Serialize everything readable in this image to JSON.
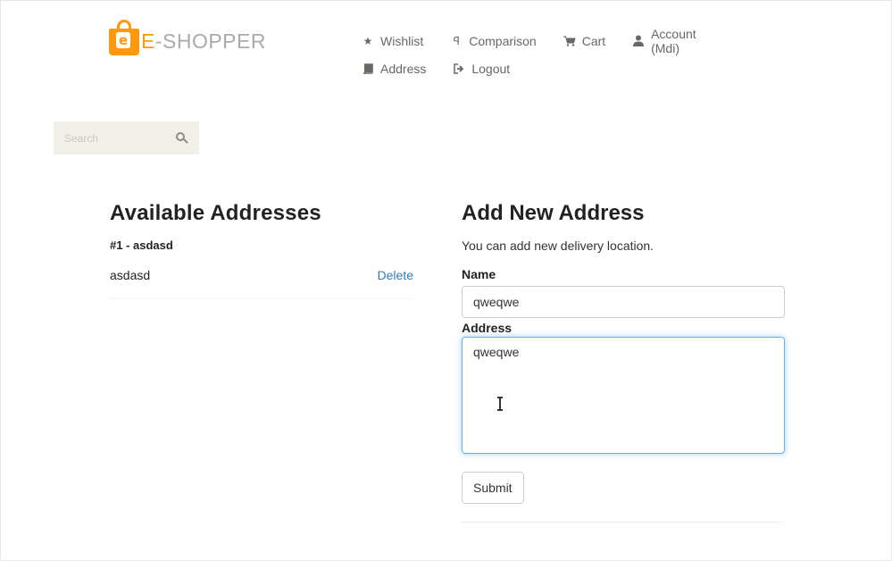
{
  "header": {
    "logo": {
      "badge": "e",
      "text_accent": "E",
      "text_rest": "-SHOPPER"
    },
    "nav": [
      {
        "label": "Wishlist",
        "icon": "star-icon"
      },
      {
        "label": "Comparison",
        "icon": "comparison-icon"
      },
      {
        "label": "Cart",
        "icon": "cart-icon"
      },
      {
        "label": "Account (Mdi)",
        "icon": "user-icon"
      },
      {
        "label": "Address",
        "icon": "book-icon"
      },
      {
        "label": "Logout",
        "icon": "sign-out-icon"
      }
    ]
  },
  "search": {
    "placeholder": "Search"
  },
  "available": {
    "heading": "Available Addresses",
    "items": [
      {
        "title": "#1 - asdasd",
        "text": "asdasd",
        "delete_label": "Delete"
      }
    ]
  },
  "add_form": {
    "heading": "Add New Address",
    "description": "You can add new delivery location.",
    "name_label": "Name",
    "name_value": "qweqwe",
    "address_label": "Address",
    "address_value": "qweqwe",
    "submit_label": "Submit"
  },
  "colors": {
    "brand": "#fe980f",
    "link": "#337ab7",
    "focus": "#66afe9"
  }
}
